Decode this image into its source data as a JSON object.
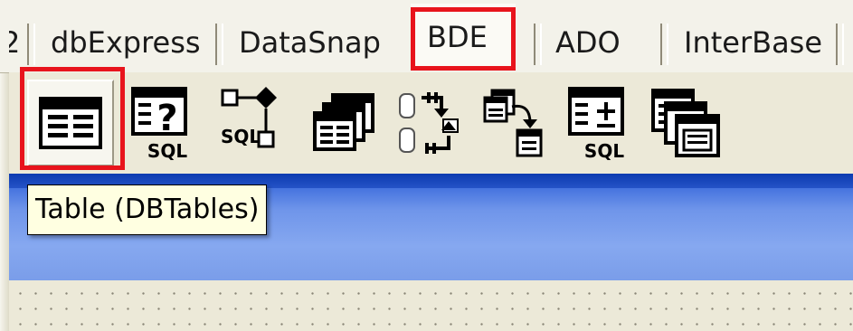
{
  "tabs": [
    {
      "id": "cut",
      "label": "2"
    },
    {
      "id": "dbexpress",
      "label": "dbExpress"
    },
    {
      "id": "datasnap",
      "label": "DataSnap"
    },
    {
      "id": "bde",
      "label": "BDE",
      "active": true
    },
    {
      "id": "ado",
      "label": "ADO"
    },
    {
      "id": "interbase",
      "label": "InterBase"
    }
  ],
  "palette": {
    "components": [
      {
        "id": "table",
        "icon": "table-icon",
        "selected": true
      },
      {
        "id": "query",
        "icon": "query-sql-icon",
        "sql_label": "SQL"
      },
      {
        "id": "storedproc",
        "icon": "stored-proc-sql-icon",
        "sql_label": "SQL"
      },
      {
        "id": "database",
        "icon": "database-icon"
      },
      {
        "id": "session",
        "icon": "session-icon"
      },
      {
        "id": "batchmove",
        "icon": "batch-move-icon"
      },
      {
        "id": "updatesql",
        "icon": "update-sql-icon",
        "sql_label": "SQL"
      },
      {
        "id": "nestedtable",
        "icon": "nested-table-icon"
      }
    ]
  },
  "tooltip": {
    "text": "Table (DBTables)"
  },
  "colors": {
    "highlight": "#e8141c",
    "tooltip_bg": "#ffffe1",
    "form_header": "#3b6bdc",
    "palette_bg": "#ece9d8"
  }
}
